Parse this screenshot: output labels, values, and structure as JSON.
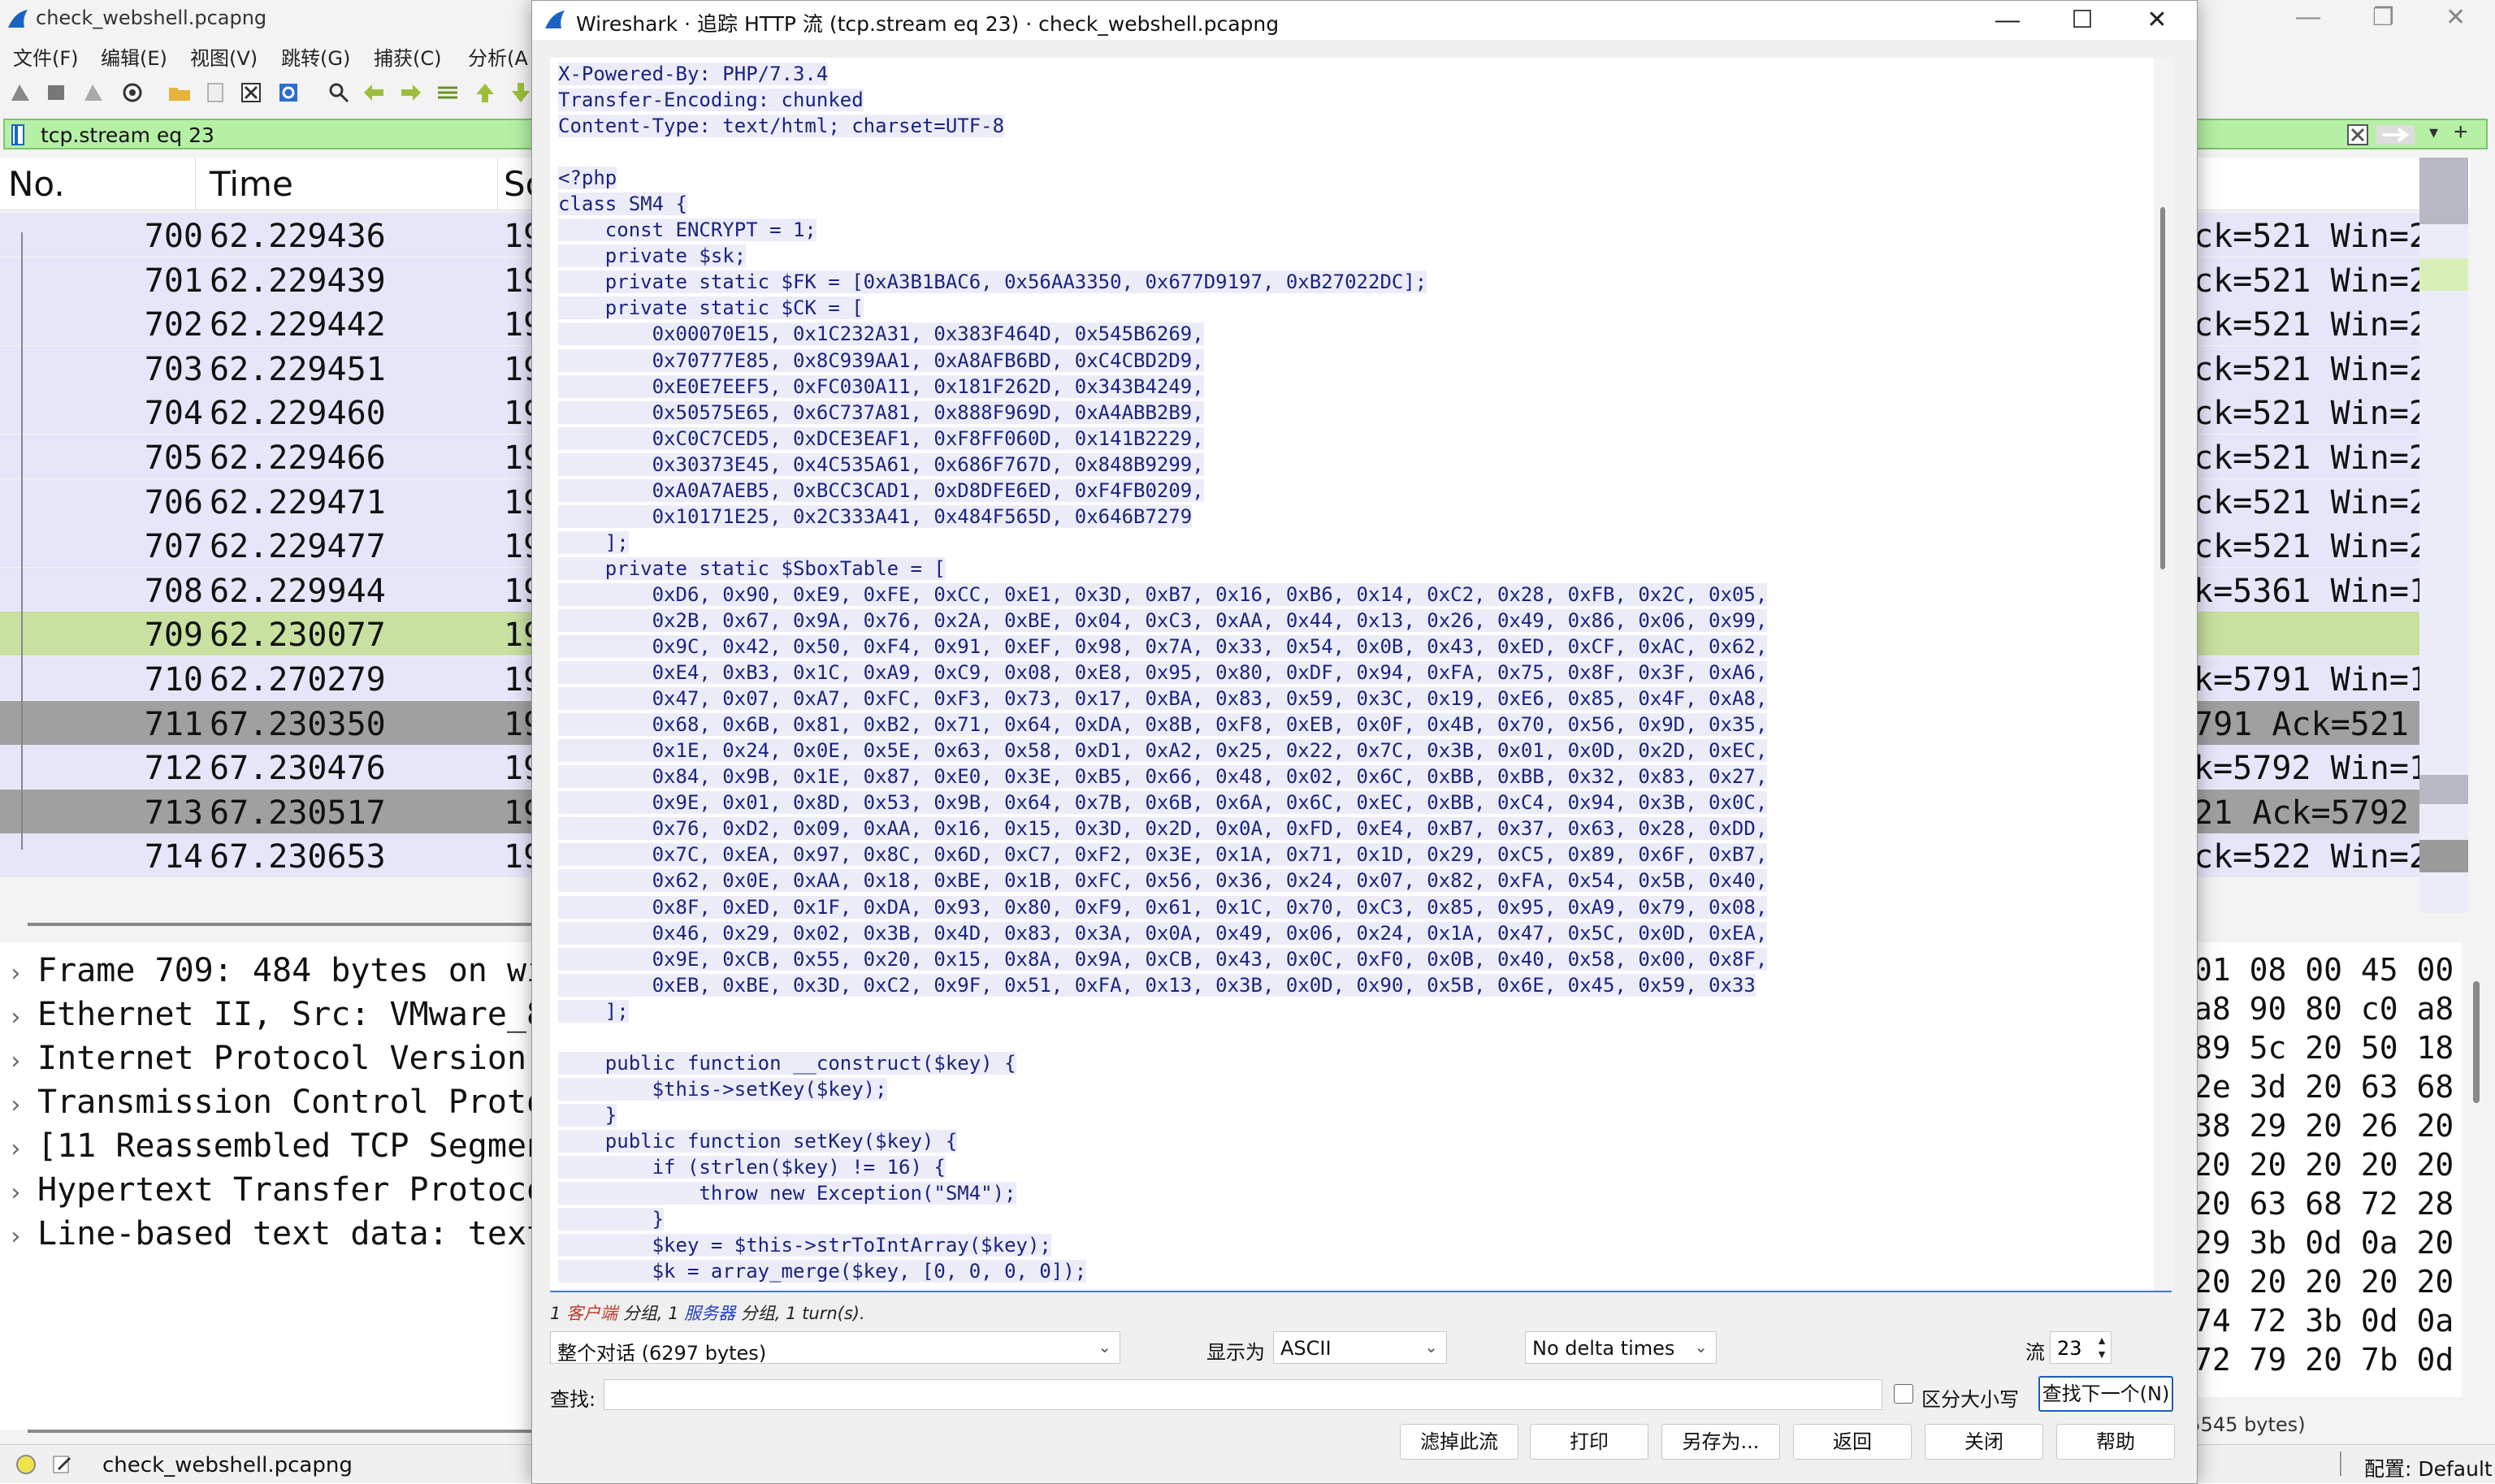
{
  "background": {
    "title": "check_webshell.pcapng",
    "menus": [
      "文件(F)",
      "编辑(E)",
      "视图(V)",
      "跳转(G)",
      "捕获(C)",
      "分析(A"
    ],
    "filter_text": "tcp.stream eq 23",
    "columns": {
      "no": "No.",
      "time": "Time",
      "source": "So"
    },
    "packets": [
      {
        "no": "700",
        "time": "62.229436",
        "src": "19",
        "info": "ck=521 Win=2",
        "style": "normal"
      },
      {
        "no": "701",
        "time": "62.229439",
        "src": "19",
        "info": "ck=521 Win=2",
        "style": "normal"
      },
      {
        "no": "702",
        "time": "62.229442",
        "src": "19",
        "info": "ck=521 Win=2",
        "style": "normal"
      },
      {
        "no": "703",
        "time": "62.229451",
        "src": "19",
        "info": "ck=521 Win=2",
        "style": "normal"
      },
      {
        "no": "704",
        "time": "62.229460",
        "src": "19",
        "info": "ck=521 Win=2",
        "style": "normal"
      },
      {
        "no": "705",
        "time": "62.229466",
        "src": "19",
        "info": "ck=521 Win=2",
        "style": "normal"
      },
      {
        "no": "706",
        "time": "62.229471",
        "src": "19",
        "info": "ck=521 Win=2",
        "style": "normal"
      },
      {
        "no": "707",
        "time": "62.229477",
        "src": "19",
        "info": "ck=521 Win=2",
        "style": "normal"
      },
      {
        "no": "708",
        "time": "62.229944",
        "src": "19",
        "info": "k=5361 Win=1",
        "style": "normal"
      },
      {
        "no": "709",
        "time": "62.230077",
        "src": "19",
        "info": "",
        "style": "selected"
      },
      {
        "no": "710",
        "time": "62.270279",
        "src": "19",
        "info": "k=5791 Win=1",
        "style": "normal"
      },
      {
        "no": "711",
        "time": "67.230350",
        "src": "19",
        "info": "791 Ack=521",
        "style": "dark"
      },
      {
        "no": "712",
        "time": "67.230476",
        "src": "19",
        "info": "k=5792 Win=1",
        "style": "normal"
      },
      {
        "no": "713",
        "time": "67.230517",
        "src": "19",
        "info": "21 Ack=5792",
        "style": "dark"
      },
      {
        "no": "714",
        "time": "67.230653",
        "src": "19",
        "info": "ck=522 Win=2",
        "style": "normal"
      }
    ],
    "details": [
      "Frame 709: 484 bytes on wi",
      "Ethernet II, Src: VMware_8",
      "Internet Protocol Version 4",
      "Transmission Control Proto",
      "[11 Reassembled TCP Segmen",
      "Hypertext Transfer Protoco",
      "Line-based text data: text,"
    ],
    "hex": [
      "01 08 00 45 00",
      "a8 90 80 c0 a8",
      "89 5c 20 50 18",
      "2e 3d 20 63 68",
      "38 29 20 26 20",
      "20 20 20 20 20",
      "20 63 68 72 28",
      "29 3b 0d 0a 20",
      "20 20 20 20 20",
      "74 72 3b 0d 0a",
      "72 79 20 7b 0d"
    ],
    "status_file": "check_webshell.pcapng",
    "status_bytes": "(5545 bytes)",
    "status_profile": "配置: Default"
  },
  "dialog": {
    "title": "Wireshark · 追踪 HTTP 流 (tcp.stream eq 23) · check_webshell.pcapng",
    "stream_lines": [
      "X-Powered-By: PHP/7.3.4",
      "Transfer-Encoding: chunked",
      "Content-Type: text/html; charset=UTF-8",
      "",
      "<?php",
      "class SM4 {",
      "    const ENCRYPT = 1;",
      "    private $sk;",
      "    private static $FK = [0xA3B1BAC6, 0x56AA3350, 0x677D9197, 0xB27022DC];",
      "    private static $CK = [",
      "        0x00070E15, 0x1C232A31, 0x383F464D, 0x545B6269,",
      "        0x70777E85, 0x8C939AA1, 0xA8AFB6BD, 0xC4CBD2D9,",
      "        0xE0E7EEF5, 0xFC030A11, 0x181F262D, 0x343B4249,",
      "        0x50575E65, 0x6C737A81, 0x888F969D, 0xA4ABB2B9,",
      "        0xC0C7CED5, 0xDCE3EAF1, 0xF8FF060D, 0x141B2229,",
      "        0x30373E45, 0x4C535A61, 0x686F767D, 0x848B9299,",
      "        0xA0A7AEB5, 0xBCC3CAD1, 0xD8DFE6ED, 0xF4FB0209,",
      "        0x10171E25, 0x2C333A41, 0x484F565D, 0x646B7279",
      "    ];",
      "    private static $SboxTable = [",
      "        0xD6, 0x90, 0xE9, 0xFE, 0xCC, 0xE1, 0x3D, 0xB7, 0x16, 0xB6, 0x14, 0xC2, 0x28, 0xFB, 0x2C, 0x05,",
      "        0x2B, 0x67, 0x9A, 0x76, 0x2A, 0xBE, 0x04, 0xC3, 0xAA, 0x44, 0x13, 0x26, 0x49, 0x86, 0x06, 0x99,",
      "        0x9C, 0x42, 0x50, 0xF4, 0x91, 0xEF, 0x98, 0x7A, 0x33, 0x54, 0x0B, 0x43, 0xED, 0xCF, 0xAC, 0x62,",
      "        0xE4, 0xB3, 0x1C, 0xA9, 0xC9, 0x08, 0xE8, 0x95, 0x80, 0xDF, 0x94, 0xFA, 0x75, 0x8F, 0x3F, 0xA6,",
      "        0x47, 0x07, 0xA7, 0xFC, 0xF3, 0x73, 0x17, 0xBA, 0x83, 0x59, 0x3C, 0x19, 0xE6, 0x85, 0x4F, 0xA8,",
      "        0x68, 0x6B, 0x81, 0xB2, 0x71, 0x64, 0xDA, 0x8B, 0xF8, 0xEB, 0x0F, 0x4B, 0x70, 0x56, 0x9D, 0x35,",
      "        0x1E, 0x24, 0x0E, 0x5E, 0x63, 0x58, 0xD1, 0xA2, 0x25, 0x22, 0x7C, 0x3B, 0x01, 0x0D, 0x2D, 0xEC,",
      "        0x84, 0x9B, 0x1E, 0x87, 0xE0, 0x3E, 0xB5, 0x66, 0x48, 0x02, 0x6C, 0xBB, 0xBB, 0x32, 0x83, 0x27,",
      "        0x9E, 0x01, 0x8D, 0x53, 0x9B, 0x64, 0x7B, 0x6B, 0x6A, 0x6C, 0xEC, 0xBB, 0xC4, 0x94, 0x3B, 0x0C,",
      "        0x76, 0xD2, 0x09, 0xAA, 0x16, 0x15, 0x3D, 0x2D, 0x0A, 0xFD, 0xE4, 0xB7, 0x37, 0x63, 0x28, 0xDD,",
      "        0x7C, 0xEA, 0x97, 0x8C, 0x6D, 0xC7, 0xF2, 0x3E, 0x1A, 0x71, 0x1D, 0x29, 0xC5, 0x89, 0x6F, 0xB7,",
      "        0x62, 0x0E, 0xAA, 0x18, 0xBE, 0x1B, 0xFC, 0x56, 0x36, 0x24, 0x07, 0x82, 0xFA, 0x54, 0x5B, 0x40,",
      "        0x8F, 0xED, 0x1F, 0xDA, 0x93, 0x80, 0xF9, 0x61, 0x1C, 0x70, 0xC3, 0x85, 0x95, 0xA9, 0x79, 0x08,",
      "        0x46, 0x29, 0x02, 0x3B, 0x4D, 0x83, 0x3A, 0x0A, 0x49, 0x06, 0x24, 0x1A, 0x47, 0x5C, 0x0D, 0xEA,",
      "        0x9E, 0xCB, 0x55, 0x20, 0x15, 0x8A, 0x9A, 0xCB, 0x43, 0x0C, 0xF0, 0x0B, 0x40, 0x58, 0x00, 0x8F,",
      "        0xEB, 0xBE, 0x3D, 0xC2, 0x9F, 0x51, 0xFA, 0x13, 0x3B, 0x0D, 0x90, 0x5B, 0x6E, 0x45, 0x59, 0x33",
      "    ];",
      "",
      "    public function __construct($key) {",
      "        $this->setKey($key);",
      "    }",
      "    public function setKey($key) {",
      "        if (strlen($key) != 16) {",
      "            throw new Exception(\"SM4\");",
      "        }",
      "        $key = $this->strToIntArray($key);",
      "        $k = array_merge($key, [0, 0, 0, 0]);"
    ],
    "turns": {
      "n1": "1 ",
      "client": "客户端",
      "mid1": " 分组, 1 ",
      "server": "服务器",
      "mid2": " 分组, 1 turn(s)."
    },
    "conversation": "整个对话 (6297 bytes)",
    "show_as_label": "显示为",
    "show_as": "ASCII",
    "delta": "No delta times",
    "stream_label": "流",
    "stream_no": "23",
    "find_label": "查找:",
    "find_value": "",
    "case_label": "区分大小写",
    "find_next": "查找下一个(N)",
    "buttons": {
      "filter_out": "滤掉此流",
      "print": "打印",
      "save_as": "另存为...",
      "back": "返回",
      "close": "关闭",
      "help": "帮助"
    }
  }
}
